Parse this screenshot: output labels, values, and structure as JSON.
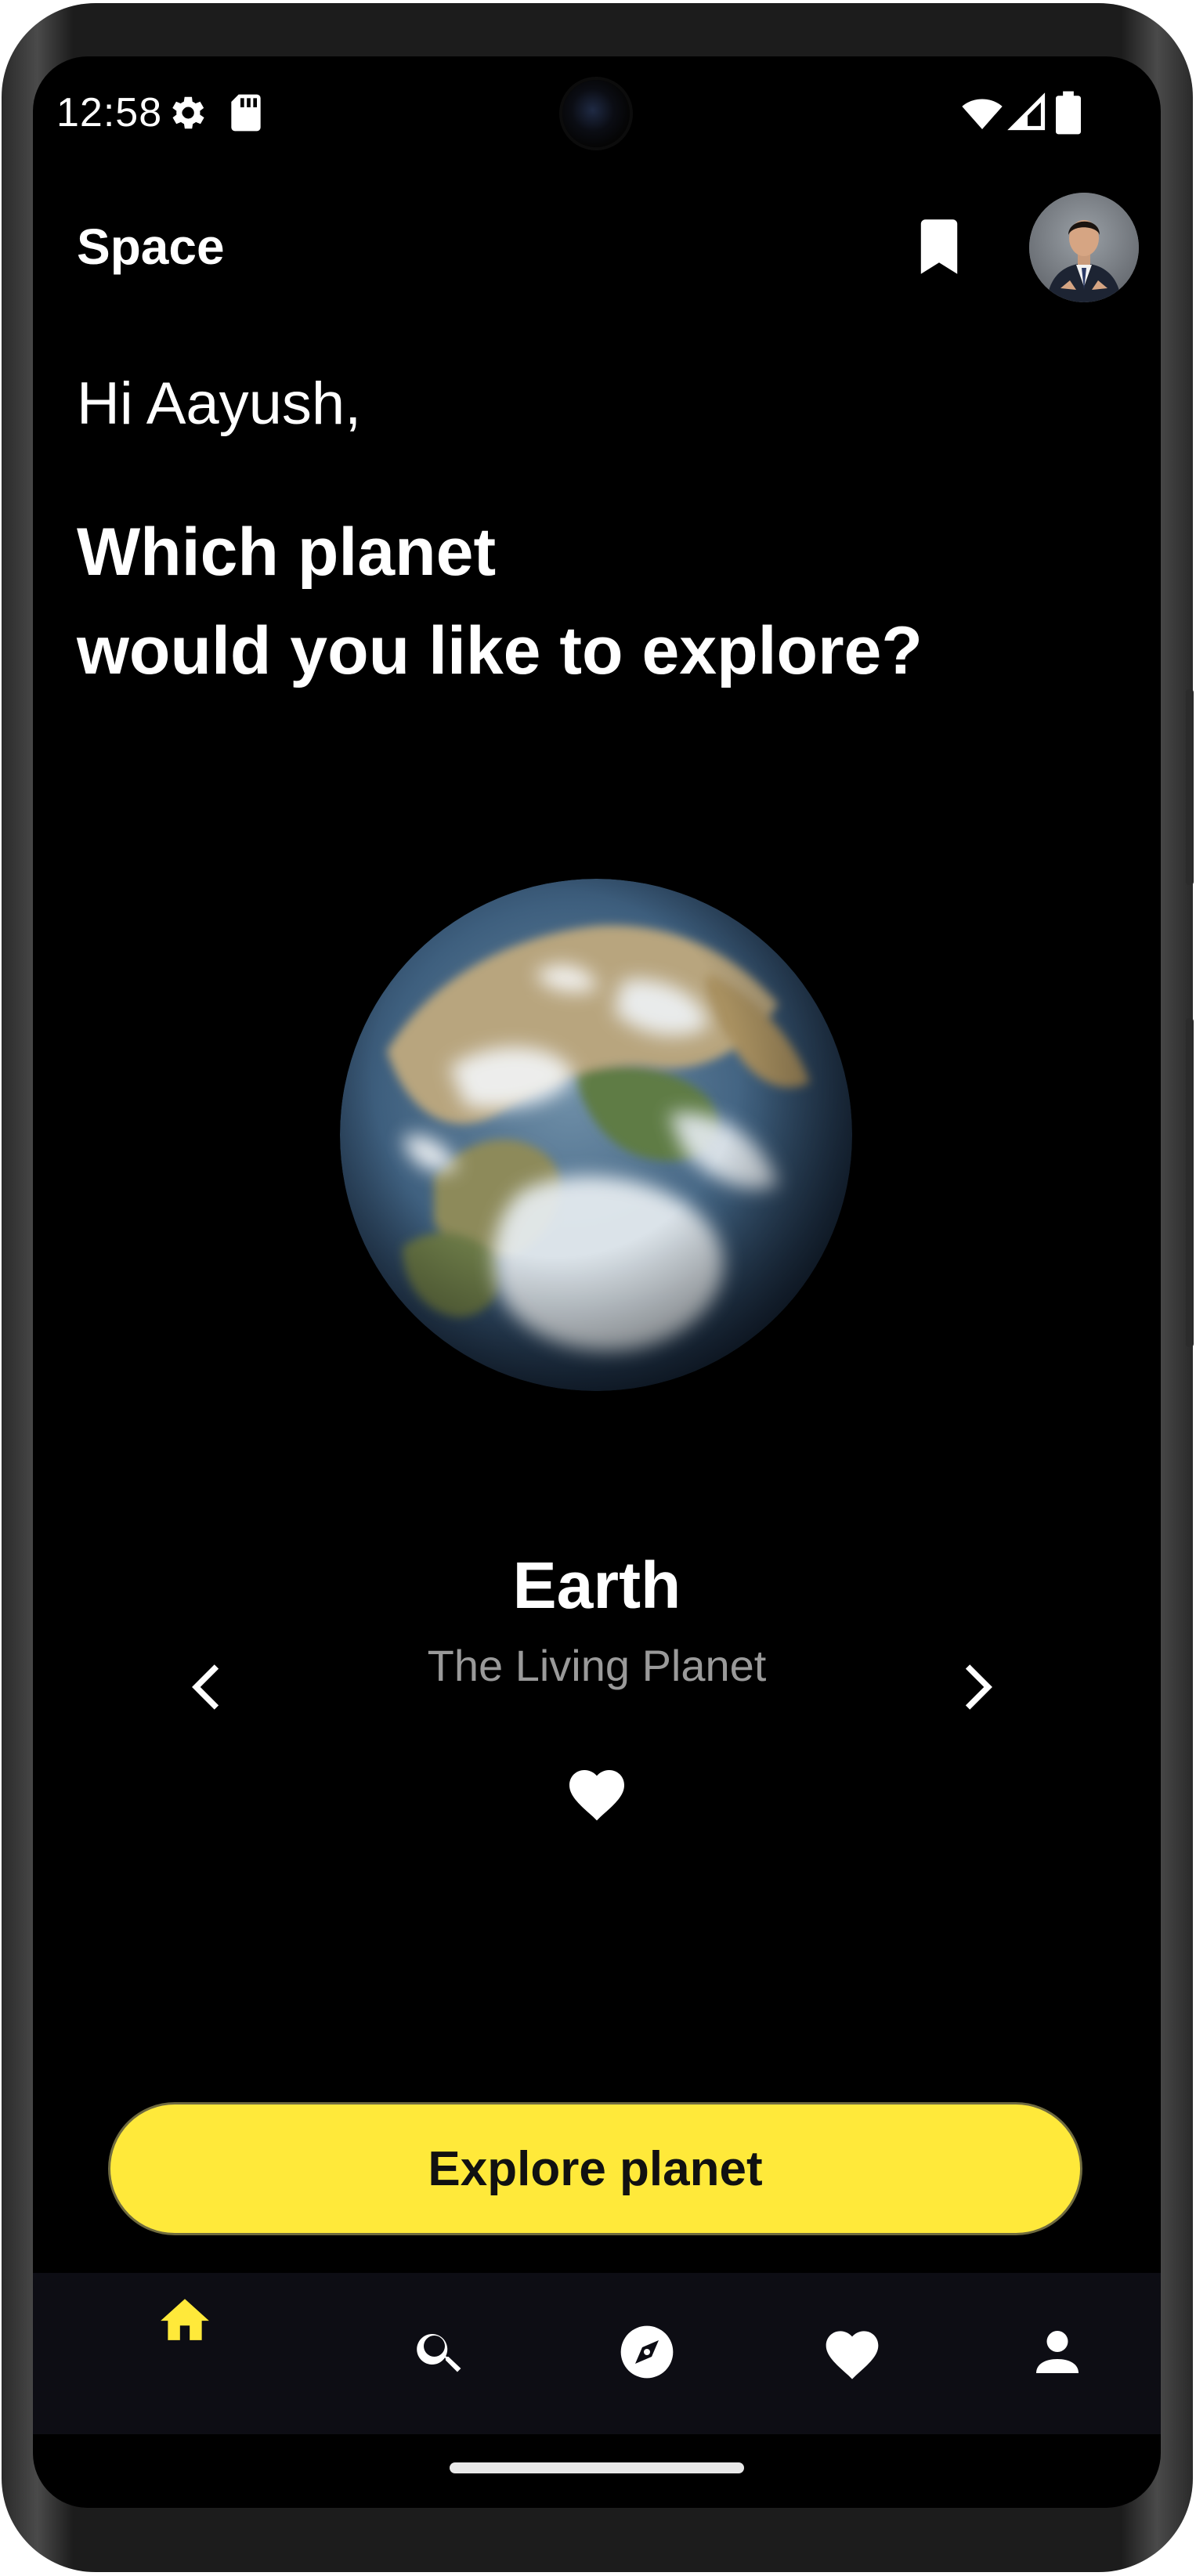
{
  "status_bar": {
    "time": "12:58",
    "icons": [
      "gear-icon",
      "sd-card-icon",
      "wifi-icon",
      "signal-icon",
      "battery-icon"
    ]
  },
  "app_bar": {
    "title": "Space",
    "icons": [
      "bookmark-icon",
      "avatar"
    ]
  },
  "main": {
    "greeting": "Hi Aayush,",
    "question_line1": "Which planet",
    "question_line2": "would you like to explore?",
    "planet": {
      "name": "Earth",
      "subtitle": "The Living Planet"
    },
    "icons": [
      "chevron-left-icon",
      "chevron-right-icon",
      "heart-icon"
    ],
    "explore_button_label": "Explore planet"
  },
  "bottom_nav": {
    "items": [
      {
        "icon": "home-icon",
        "active": true
      },
      {
        "icon": "search-icon",
        "active": false
      },
      {
        "icon": "compass-icon",
        "active": false
      },
      {
        "icon": "heart-icon",
        "active": false
      },
      {
        "icon": "person-icon",
        "active": false
      }
    ]
  },
  "colors": {
    "background": "#000000",
    "accent": "#ffe93a",
    "nav_background": "#0d0d14",
    "subtitle_text": "#9a9a9a"
  }
}
